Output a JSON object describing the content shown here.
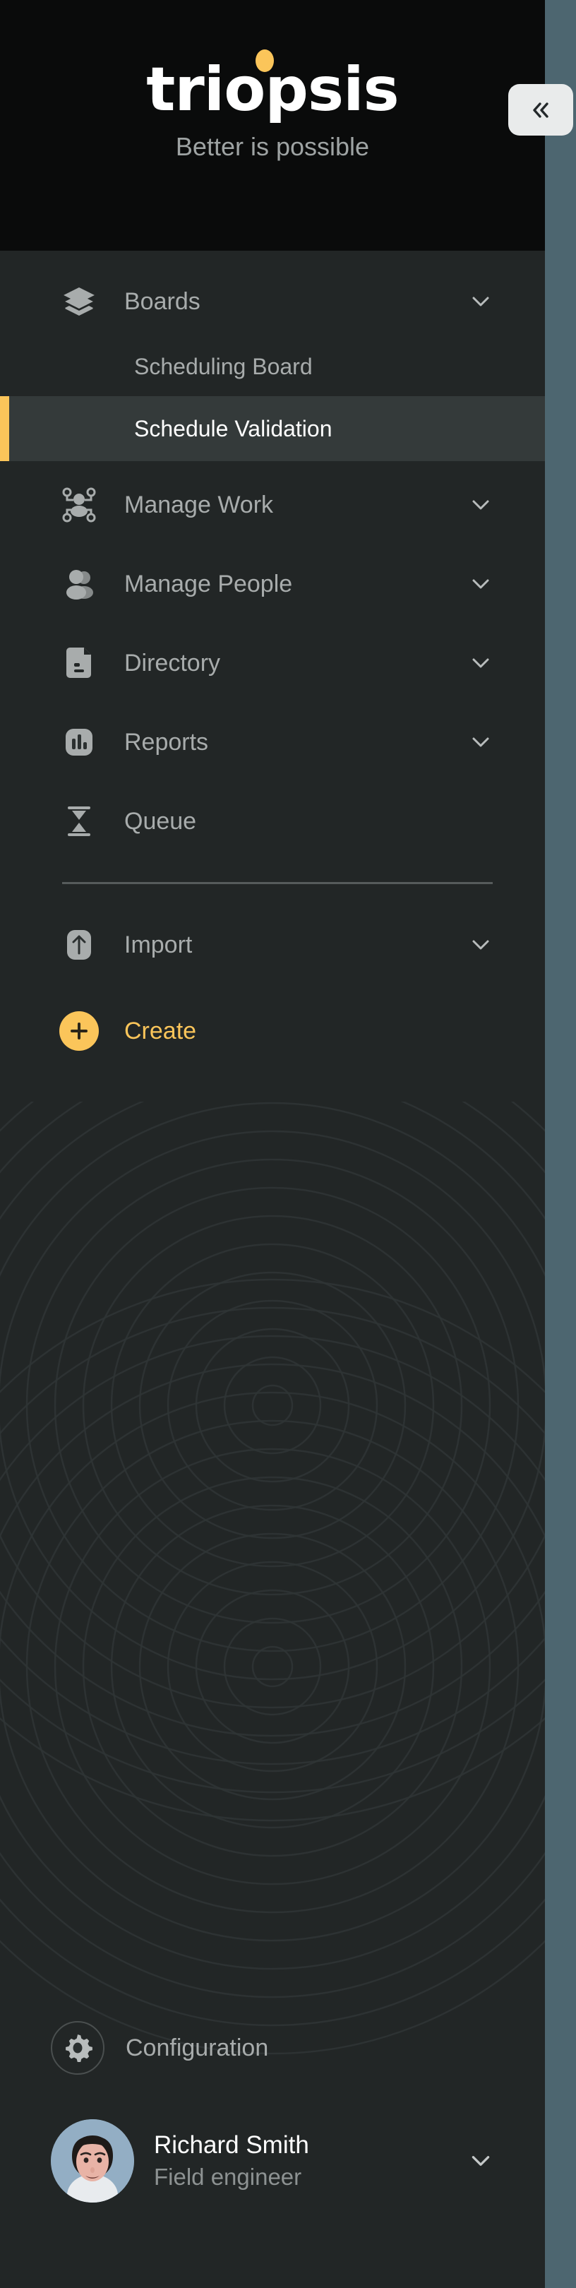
{
  "brand": {
    "name": "triopsis",
    "tagline": "Better is possible",
    "accent_color": "#fbc55a",
    "header_bg": "#0a0b0b"
  },
  "collapse_button": {
    "icon": "chevron-double-left-icon",
    "label": "«"
  },
  "sidebar": {
    "bg": "#222626",
    "active_bg": "#343a3a",
    "active_bar_color": "#fbc55a",
    "text_color": "#a8acac",
    "items": [
      {
        "id": "boards",
        "label": "Boards",
        "icon": "layers-stack-icon",
        "expandable": true,
        "chevron": "chevron-down-icon",
        "children": [
          {
            "id": "scheduling-board",
            "label": "Scheduling Board",
            "active": false
          },
          {
            "id": "schedule-validation",
            "label": "Schedule Validation",
            "active": true
          }
        ]
      },
      {
        "id": "manage-work",
        "label": "Manage Work",
        "icon": "work-network-icon",
        "expandable": true,
        "chevron": "chevron-down-icon"
      },
      {
        "id": "manage-people",
        "label": "Manage People",
        "icon": "people-group-icon",
        "expandable": true,
        "chevron": "chevron-down-icon"
      },
      {
        "id": "directory",
        "label": "Directory",
        "icon": "document-icon",
        "expandable": true,
        "chevron": "chevron-down-icon"
      },
      {
        "id": "reports",
        "label": "Reports",
        "icon": "bar-chart-icon",
        "expandable": true,
        "chevron": "chevron-down-icon"
      },
      {
        "id": "queue",
        "label": "Queue",
        "icon": "hourglass-icon",
        "expandable": false
      }
    ],
    "secondary_items": [
      {
        "id": "import",
        "label": "Import",
        "icon": "upload-arrow-icon",
        "expandable": true,
        "chevron": "chevron-down-icon"
      },
      {
        "id": "create",
        "label": "Create",
        "icon": "plus-circle-icon",
        "expandable": false,
        "color": "#fbc55a"
      }
    ]
  },
  "footer": {
    "configuration": {
      "label": "Configuration",
      "icon": "gear-icon"
    },
    "user": {
      "name": "Richard Smith",
      "role": "Field engineer",
      "avatar": "user-avatar-photo",
      "chevron": "chevron-down-icon"
    }
  },
  "canvas": {
    "background_color": "#4d6670"
  }
}
